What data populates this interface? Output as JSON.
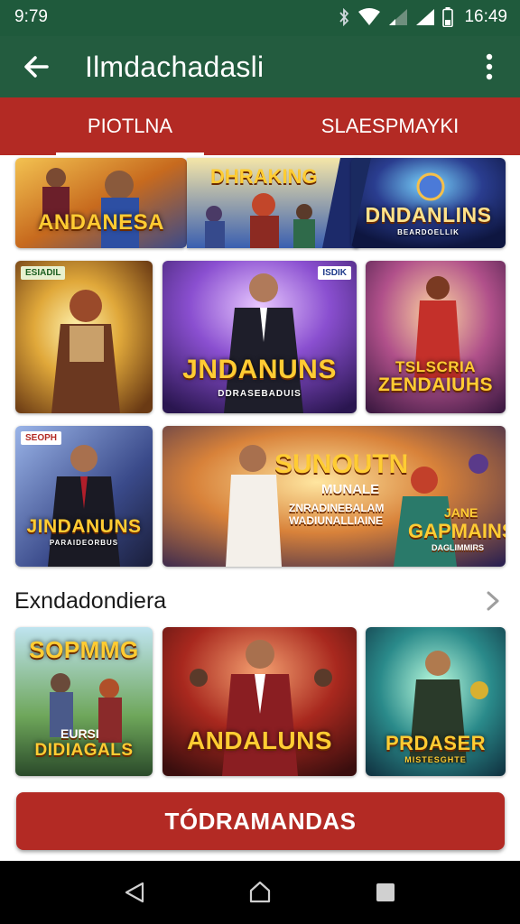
{
  "status_bar": {
    "time_left": "9:79",
    "time_right": "16:49",
    "icons": [
      "bluetooth-icon",
      "wifi-icon",
      "signal-icon",
      "signal-icon",
      "battery-icon"
    ]
  },
  "app_bar": {
    "title": "Ilmdachadasli",
    "back_icon": "arrow-left-icon",
    "menu_icon": "more-vert-icon"
  },
  "tabs": [
    {
      "label": "PIOTLNA",
      "active": true
    },
    {
      "label": "SLAESPMAYKI",
      "active": false
    }
  ],
  "banner_cards": [
    {
      "title": "ANDANESA"
    },
    {
      "title": "DHRAKING"
    },
    {
      "title": "DNDANLINS",
      "subtitle": "BEARDOELLIK"
    }
  ],
  "grid_row1": [
    {
      "badge": "ESIADIL"
    },
    {
      "title": "JNDANUNS",
      "subtitle": "DDRASEBADUIS",
      "badge": "ISDIK"
    },
    {
      "title_line1": "TSLSCRIA",
      "title_line2": "ZENDAIUHS"
    }
  ],
  "grid_row2": [
    {
      "badge": "SEOPH",
      "title": "JINDANUNS",
      "subtitle": "PARAIDEORBUS"
    },
    {
      "title": "SUNOUTN",
      "line2": "MUNALE",
      "line3": "ZNRADINEBALAM",
      "line4": "WADIUNALLIAINE",
      "right_title_1": "JANE",
      "right_title_2": "GAPMAINS",
      "right_sub": "DAGLIMMIRS"
    }
  ],
  "section": {
    "title": "Exndadondiera",
    "chevron_icon": "chevron-right-icon"
  },
  "section_cards": [
    {
      "title": "SOPMMG",
      "line2": "EURSI",
      "line3": "DIDIAGALS"
    },
    {
      "title": "ANDALUNS"
    },
    {
      "title": "PRDASER",
      "subtitle": "MISTESGHTE"
    }
  ],
  "cta": {
    "label": "TÓDRAMANDAS"
  },
  "nav": {
    "back_icon": "triangle-back-icon",
    "home_icon": "circle-home-icon",
    "recents_icon": "square-recents-icon"
  },
  "colors": {
    "status_green": "#1f5a3c",
    "appbar_green": "#235c3f",
    "accent_red": "#b32a24",
    "title_gold": "#ffcc33"
  }
}
